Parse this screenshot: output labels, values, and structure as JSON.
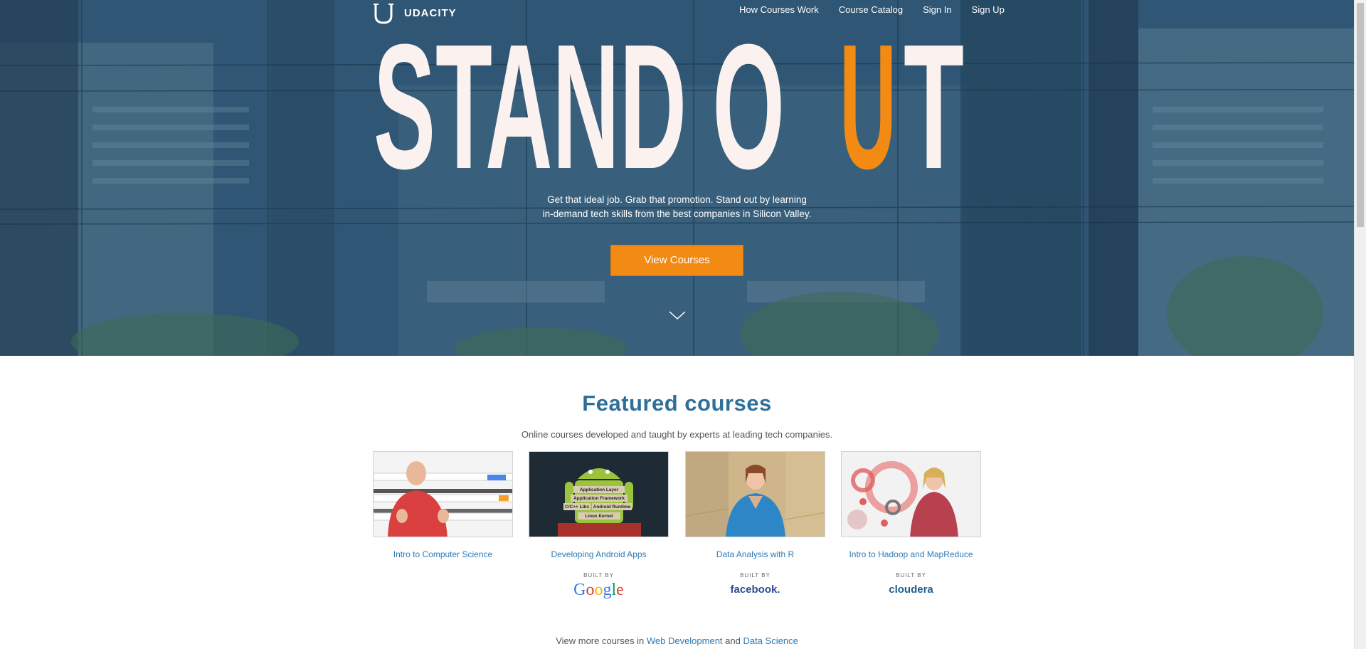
{
  "nav": {
    "logo_text": "UDACITY",
    "links": [
      "How Courses Work",
      "Course Catalog",
      "Sign In",
      "Sign Up"
    ]
  },
  "hero": {
    "headline_part1": "STAND O",
    "headline_accent": "U",
    "headline_part2": "T",
    "subhead_line1": "Get that ideal job. Grab that promotion. Stand out by learning",
    "subhead_line2": "in-demand tech skills from the best companies in Silicon Valley.",
    "cta_label": "View Courses",
    "accent_color": "#f28a14"
  },
  "featured": {
    "title": "Featured courses",
    "subtitle": "Online courses developed and taught by experts at leading tech companies.",
    "courses": [
      {
        "title": "Intro to Computer Science",
        "built_by": "",
        "partner": ""
      },
      {
        "title": "Developing Android Apps",
        "built_by": "BUILT BY",
        "partner": "Google"
      },
      {
        "title": "Data Analysis with R",
        "built_by": "BUILT BY",
        "partner": "facebook."
      },
      {
        "title": "Intro to Hadoop and MapReduce",
        "built_by": "BUILT BY",
        "partner": "cloudera"
      }
    ],
    "android_labels": [
      "Application Layer",
      "Application Framework",
      "C/C++ Libs",
      "Android Runtime",
      "Linux Kernel"
    ]
  },
  "more": {
    "prefix": "View more courses in ",
    "link1": "Web Development",
    "and": " and ",
    "link2": "Data Science"
  }
}
